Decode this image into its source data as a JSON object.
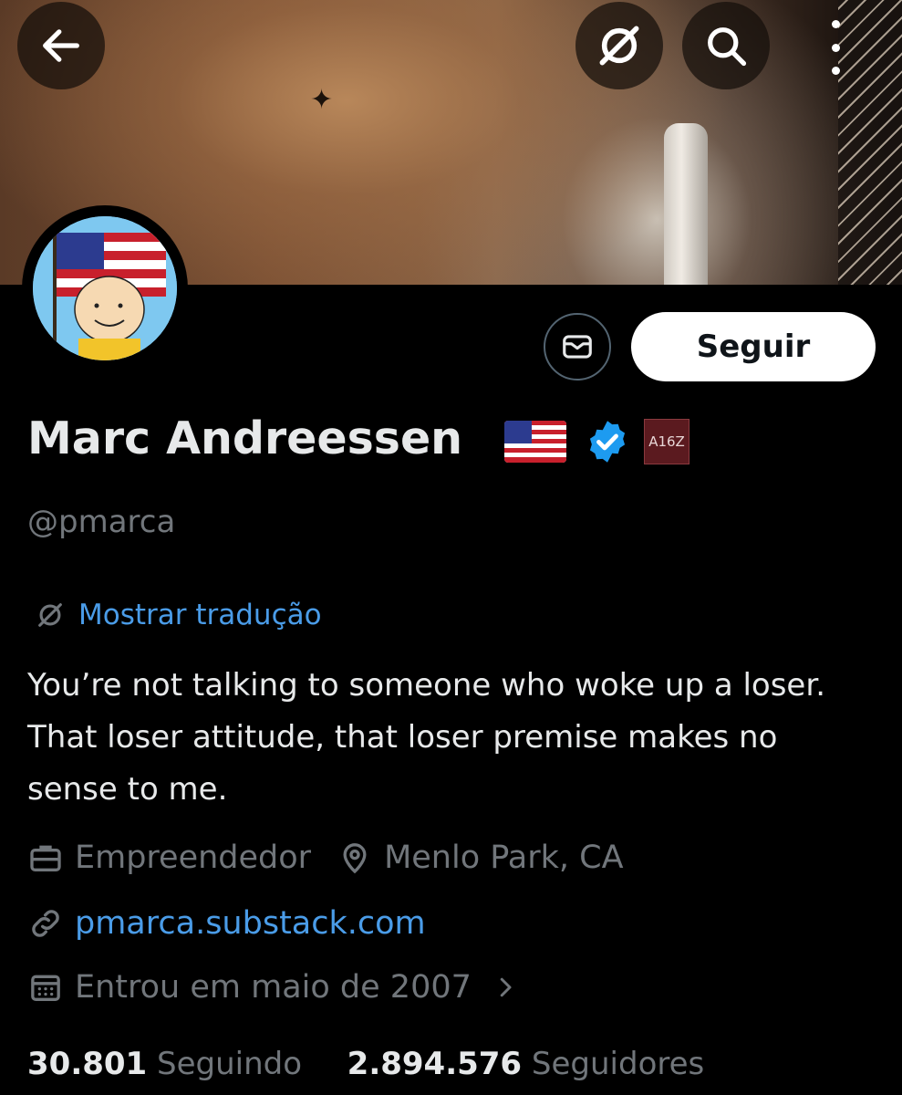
{
  "header": {
    "back_icon": "arrow-left-icon",
    "translate_icon": "translate-icon",
    "search_icon": "search-icon",
    "more_icon": "more-vertical-icon"
  },
  "profile": {
    "name": "Marc Andreessen",
    "handle": "@pmarca",
    "affiliation_badge": "A16Z",
    "follow_label": "Seguir",
    "message_icon": "envelope-icon",
    "translate_label": "Mostrar tradução",
    "bio": "You’re not talking to someone who woke up a loser. That loser attitude, that loser premise makes no sense to me.",
    "category": "Empreendedor",
    "location": "Menlo Park, CA",
    "website": "pmarca.substack.com",
    "joined": "Entrou em maio de 2007",
    "following_count": "30.801",
    "following_label": "Seguindo",
    "followers_count": "2.894.576",
    "followers_label": "Seguidores"
  },
  "colors": {
    "background": "#000000",
    "text": "#e7e9ea",
    "muted": "#71767b",
    "link": "#4a9ce8",
    "verified": "#1d9bf0"
  }
}
